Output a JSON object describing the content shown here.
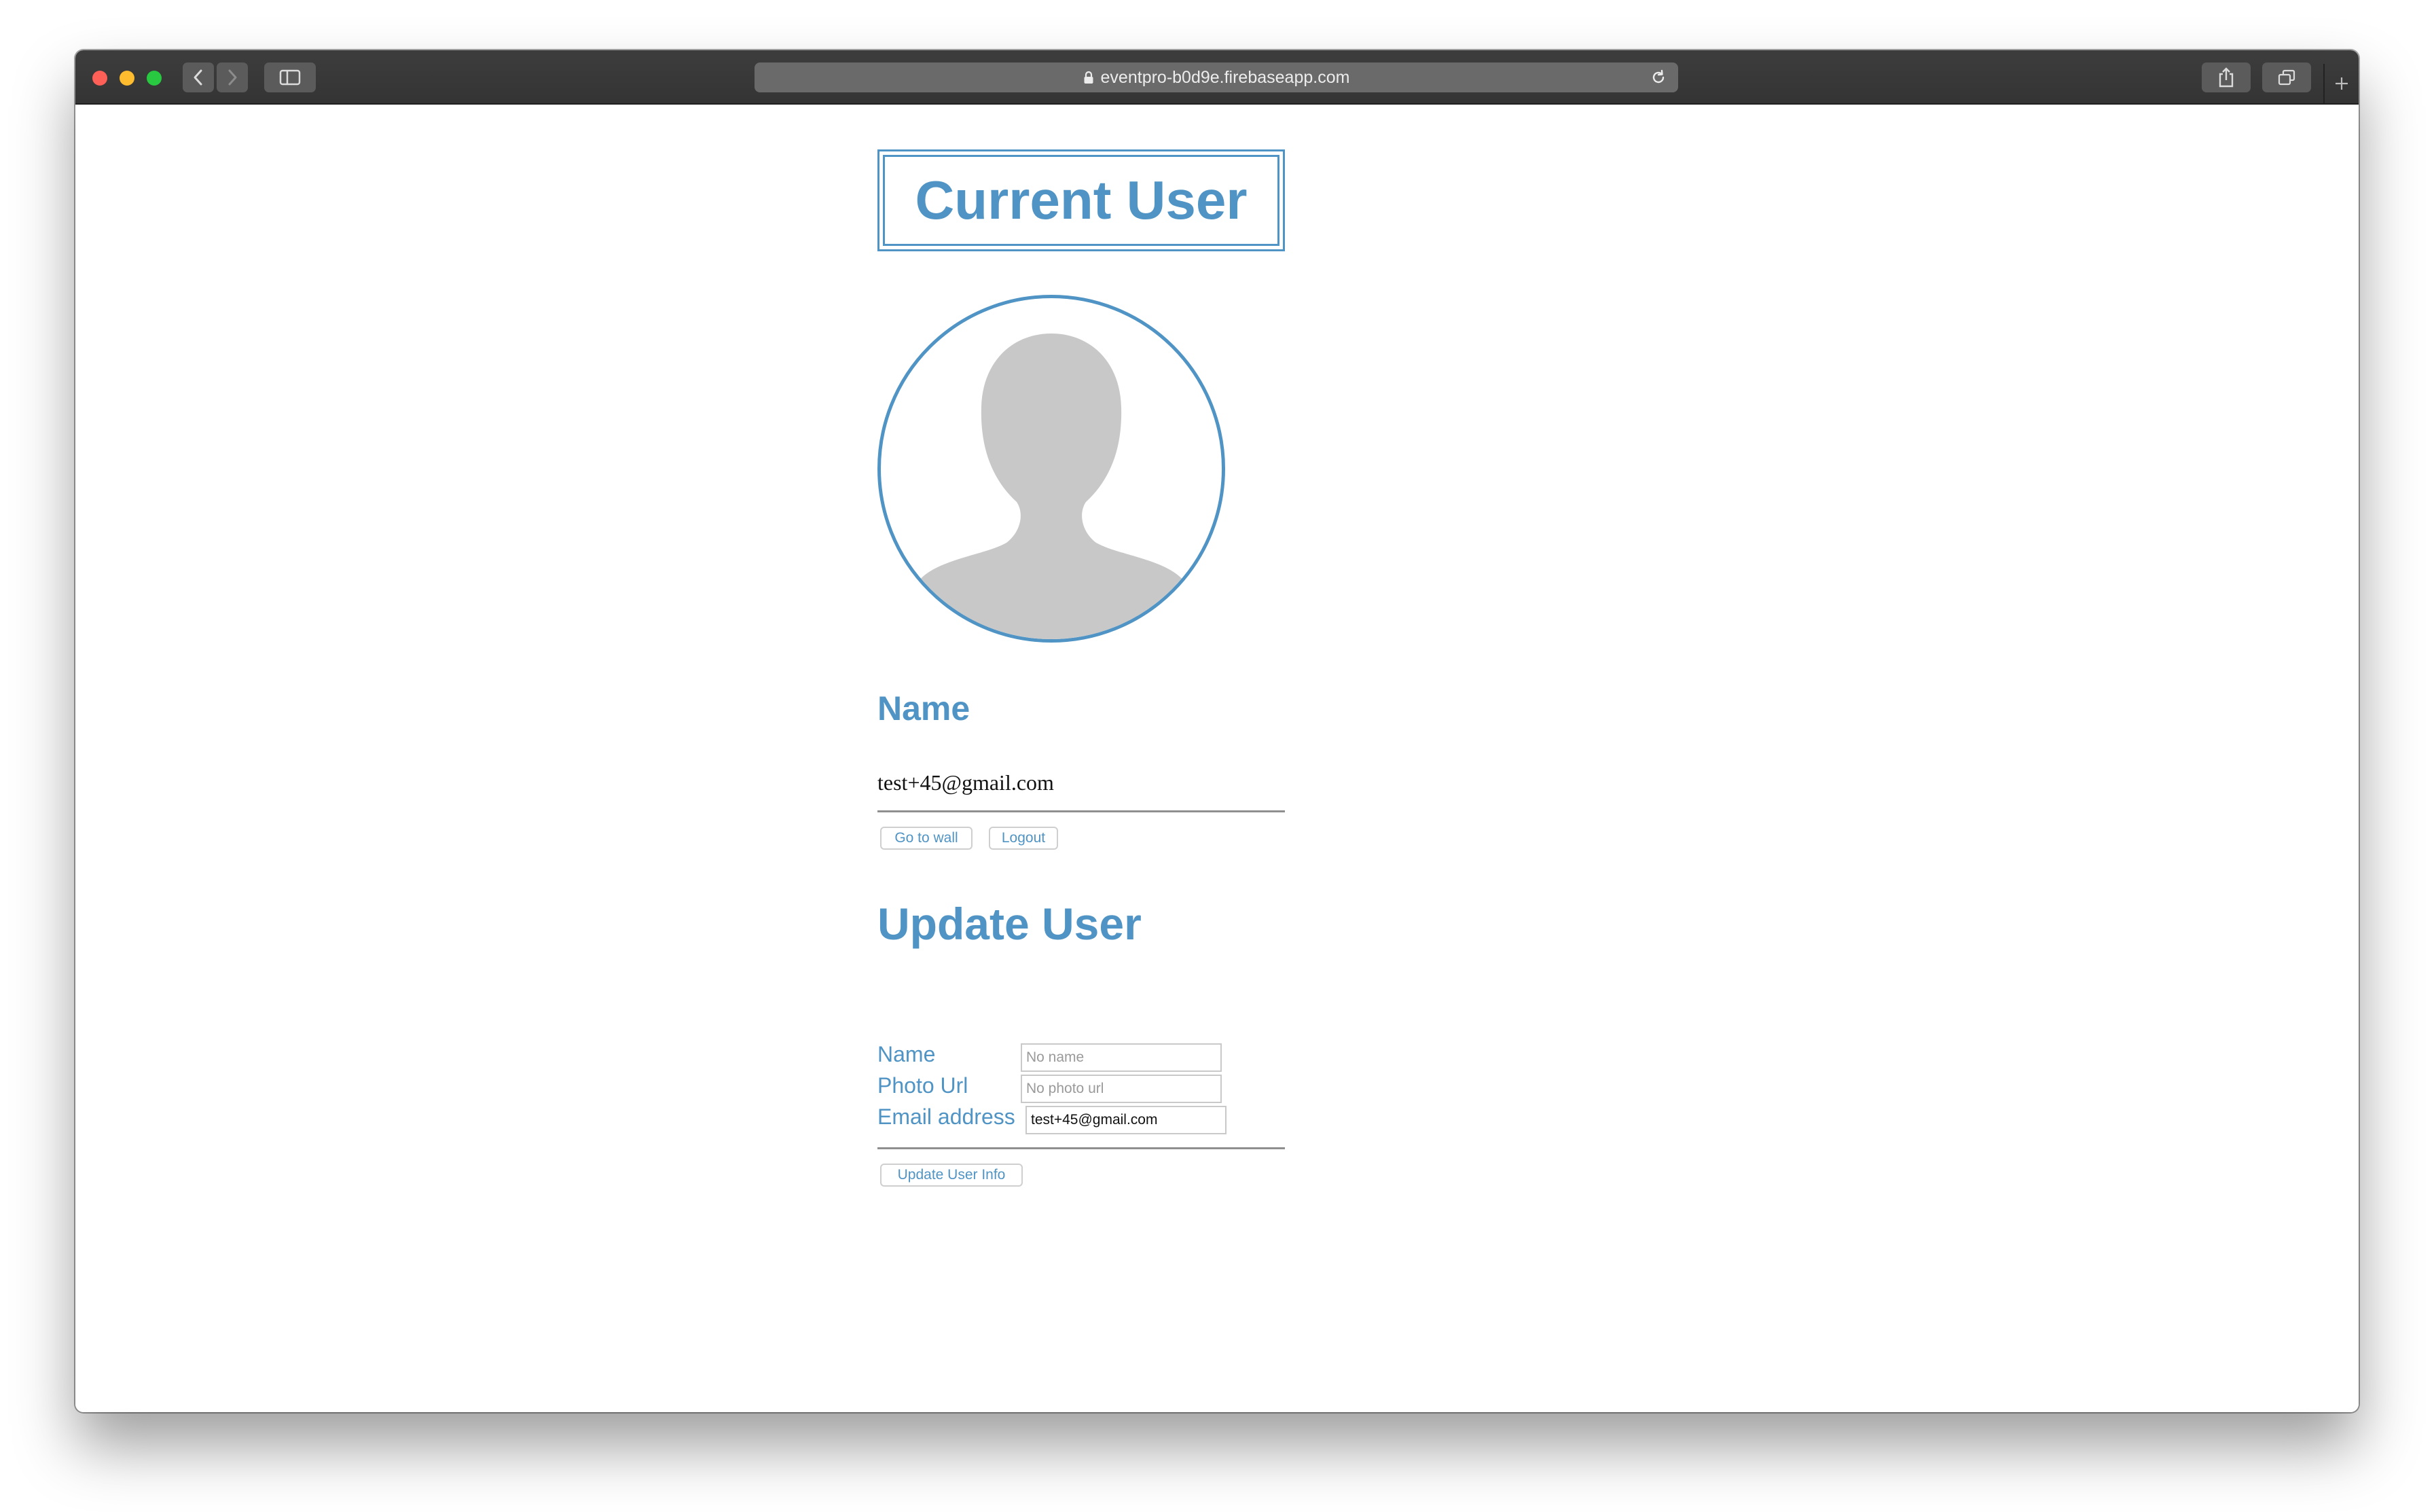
{
  "browser": {
    "url": "eventpro-b0d9e.firebaseapp.com",
    "icons": {
      "back": "chevron-left-icon",
      "forward": "chevron-right-icon",
      "sidebar": "sidebar-icon",
      "lock": "lock-icon",
      "reload": "reload-icon",
      "share": "share-icon",
      "tabs": "tabs-icon",
      "new_tab": "plus-icon"
    }
  },
  "page": {
    "title": "Current User",
    "avatar_icon": "default-avatar-icon",
    "name_heading": "Name",
    "current_email": "test+45@gmail.com",
    "buttons": {
      "go_to_wall": "Go to wall",
      "logout": "Logout"
    },
    "update": {
      "heading": "Update User",
      "name_label": "Name",
      "name_value": "",
      "name_placeholder": "No name",
      "photo_label": "Photo Url",
      "photo_value": "",
      "photo_placeholder": "No photo url",
      "email_label": "Email address",
      "email_value": "test+45@gmail.com",
      "submit": "Update User Info"
    }
  },
  "colors": {
    "accent": "#4f94c4",
    "toolbar": "#3a3a3a"
  }
}
